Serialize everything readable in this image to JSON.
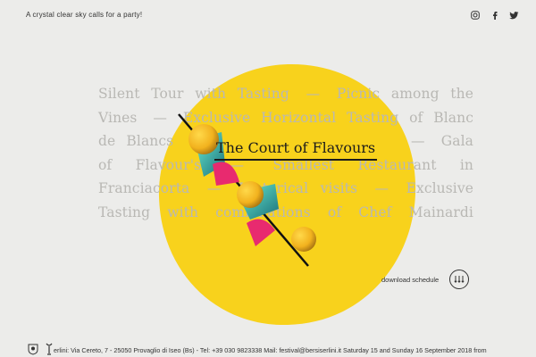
{
  "header": {
    "tagline": "A crystal clear sky calls for a party!",
    "social": [
      {
        "icon": "instagram-icon"
      },
      {
        "icon": "facebook-icon"
      },
      {
        "icon": "twitter-icon"
      }
    ]
  },
  "events": {
    "lines": [
      [
        "Silent Tour with Tasting",
        "—",
        "Picnic among the"
      ],
      [
        "Vines",
        "—",
        "Exclusive Horizontal Tasting of Blanc"
      ],
      [
        "de Blancs",
        "—",
        "The Court of Flavours",
        "—",
        "Gala"
      ],
      [
        "of Flavour's",
        "—",
        "Smallest Restaurant in"
      ],
      [
        "Franciacorta",
        "—",
        "Historical visits",
        "—",
        "Exclusive"
      ],
      [
        "Tasting with combinations of Chef Mainardi"
      ]
    ],
    "highlighted": "The Court of Flavours"
  },
  "colors": {
    "background": "#ececea",
    "blob": "#f8d21c",
    "accent_teal": "#4fe3c4",
    "accent_pink": "#e82a6f"
  },
  "download": {
    "label": "download schedule",
    "icon": "three-arrows-down-icon"
  },
  "footer": {
    "text": "erlini: Via Cereto, 7 - 25050 Provaglio di Iseo (Bs) - Tel: +39 030 9823338 Mail: festival@bersiserlini.it     Saturday 15 and Sunday 16 September 2018 from",
    "logos": [
      "crest-logo-icon",
      "glass-logo-icon"
    ]
  }
}
